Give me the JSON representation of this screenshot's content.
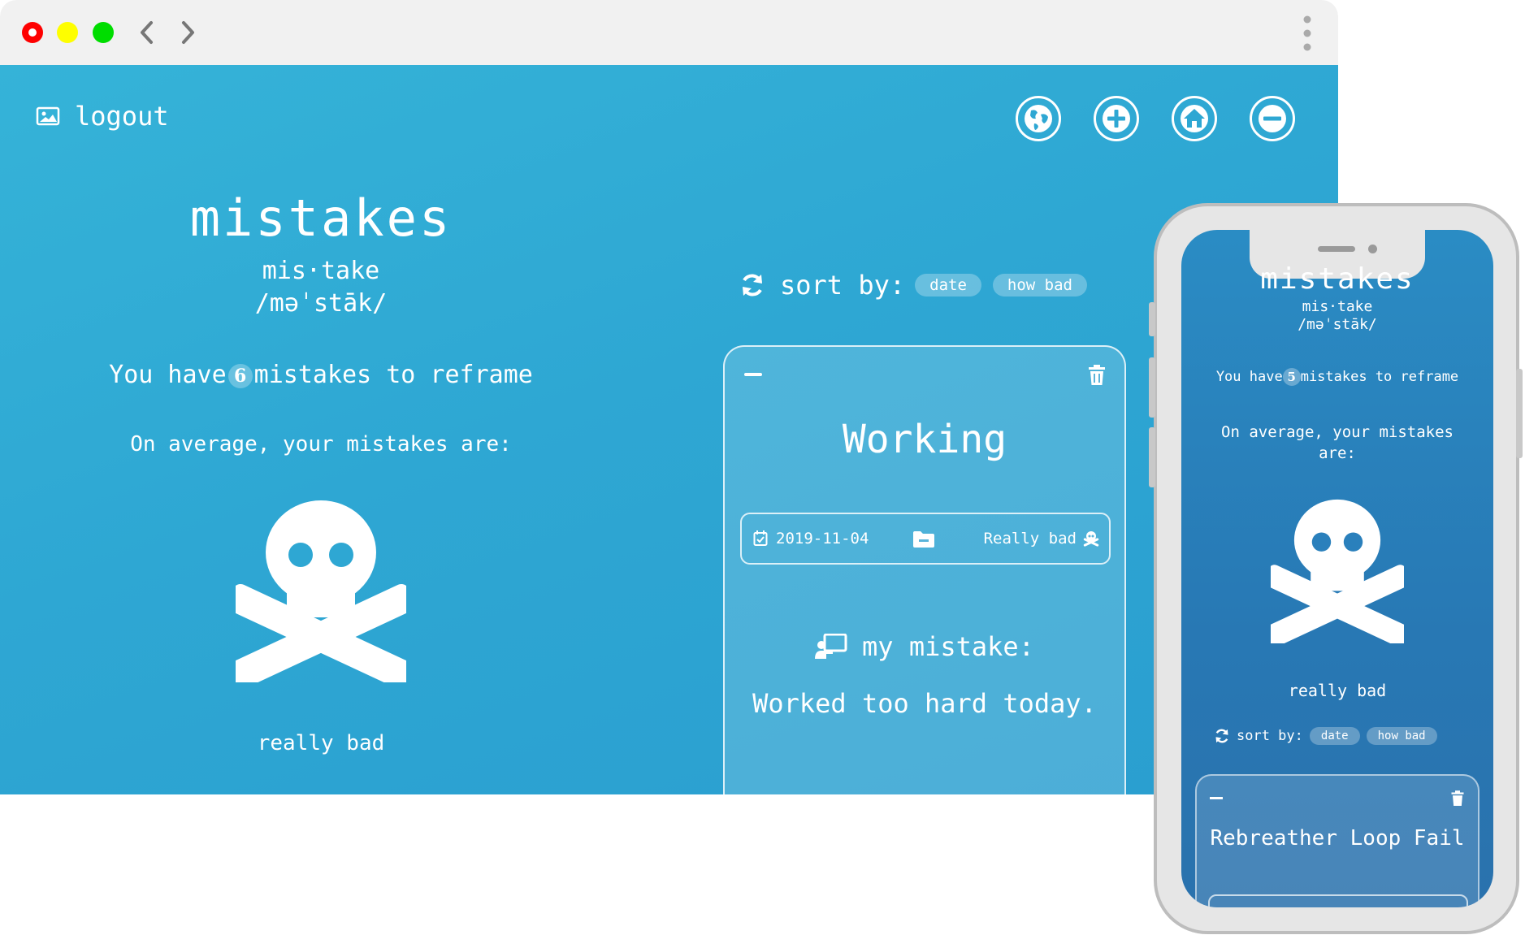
{
  "desktop": {
    "header": {
      "logout_label": "logout"
    },
    "hero": {
      "title": "mistakes",
      "syllables": "mis·take",
      "pronunciation": "/məˈstāk/",
      "count_prefix": "You have",
      "count": "6",
      "count_suffix": "mistakes to reframe",
      "average_label": "On average, your mistakes are:",
      "severity": "really bad"
    },
    "sort": {
      "label": "sort by:",
      "options": [
        "date",
        "how bad"
      ]
    },
    "card": {
      "title": "Working",
      "date": "2019-11-04",
      "severity": "Really bad",
      "subtitle": "my mistake:",
      "text": "Worked too hard today."
    }
  },
  "mobile": {
    "title": "mistakes",
    "syllables": "mis·take",
    "pronunciation": "/məˈstāk/",
    "count_prefix": "You have",
    "count": "5",
    "count_suffix": "mistakes to reframe",
    "average_label": "On average, your mistakes are:",
    "severity": "really bad",
    "sort": {
      "label": "sort by:",
      "options": [
        "date",
        "how bad"
      ]
    },
    "card": {
      "title": "Rebreather Loop Fail"
    }
  },
  "icons": {
    "toolbar": [
      "globe-icon",
      "plus-icon",
      "home-icon",
      "minus-icon"
    ],
    "colors": {
      "page_bg": "#2ea7d3",
      "mobile_bg": "#2878b4",
      "chrome_bg": "#f1f1f1"
    }
  }
}
